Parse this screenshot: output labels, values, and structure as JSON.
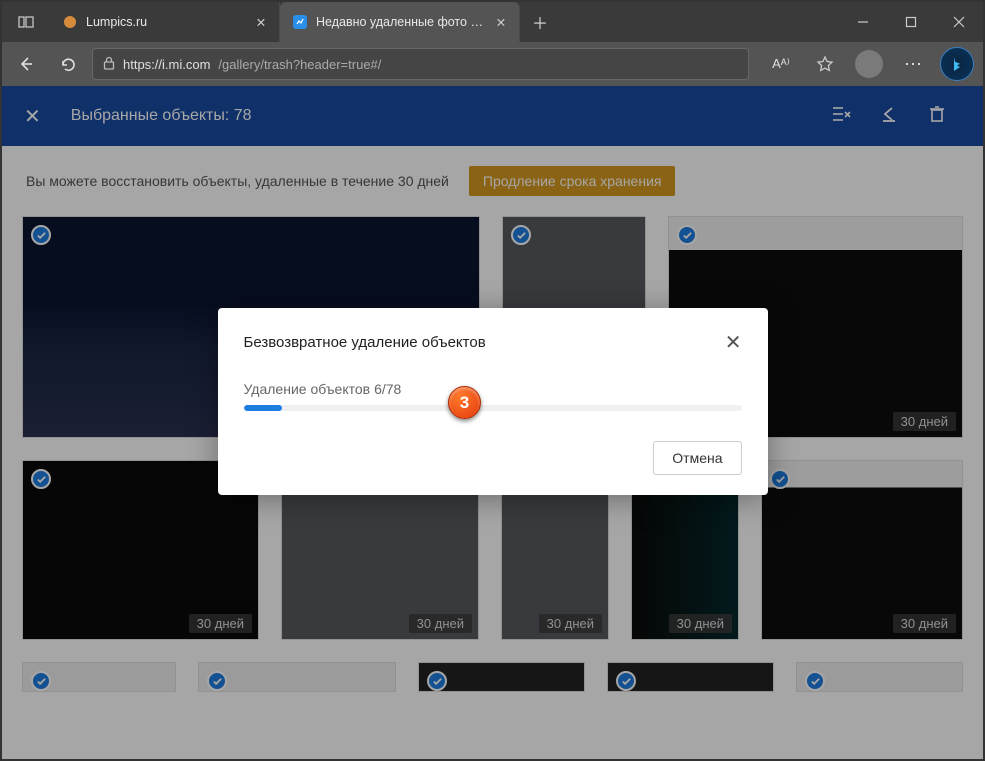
{
  "browser": {
    "tabs": [
      {
        "title": "Lumpics.ru",
        "active": false
      },
      {
        "title": "Недавно удаленные фото и ви…",
        "active": true
      }
    ],
    "url_host": "https://i.mi.com",
    "url_path": "/gallery/trash?header=true#/",
    "icons": {
      "read_aloud": "Aᴬ⁾",
      "favorite": "☆",
      "more": "⋯"
    }
  },
  "header": {
    "selection_text": "Выбранные объекты: 78"
  },
  "notice": {
    "text": "Вы можете восстановить объекты, удаленные в течение 30 дней",
    "extend_button": "Продление срока хранения"
  },
  "thumbs": {
    "days_label": "30 дней"
  },
  "modal": {
    "title": "Безвозвратное удаление объектов",
    "status_prefix": "Удаление объектов",
    "status_count": "6/78",
    "cancel": "Отмена"
  },
  "annotation": {
    "number": "3"
  }
}
